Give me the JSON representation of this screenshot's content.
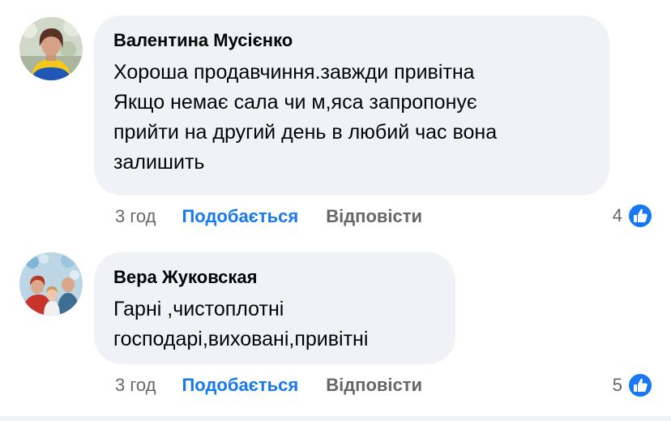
{
  "comments": [
    {
      "author": "Валентина Мусієнко",
      "text": "Хороша продавчиння.завжди привітна\nЯкщо немає сала чи м,яса запропонує\nприйти на другий день в любий час вона\nзалишить",
      "time": "3 год",
      "like_label": "Подобається",
      "reply_label": "Відповісти",
      "reactions_count": "4",
      "avatar_icon": "profile-photo"
    },
    {
      "author": "Вера Жуковская",
      "text": "Гарні  ,чистоплотні\nгосподарі,виховані,привітні",
      "time": "3 год",
      "like_label": "Подобається",
      "reply_label": "Відповісти",
      "reactions_count": "5",
      "avatar_icon": "profile-photo"
    }
  ],
  "colors": {
    "bubble": "#f0f2f5",
    "like_blue": "#1877f2",
    "secondary_text": "#65676b"
  },
  "icons": {
    "reaction": "thumbs-up-icon"
  }
}
